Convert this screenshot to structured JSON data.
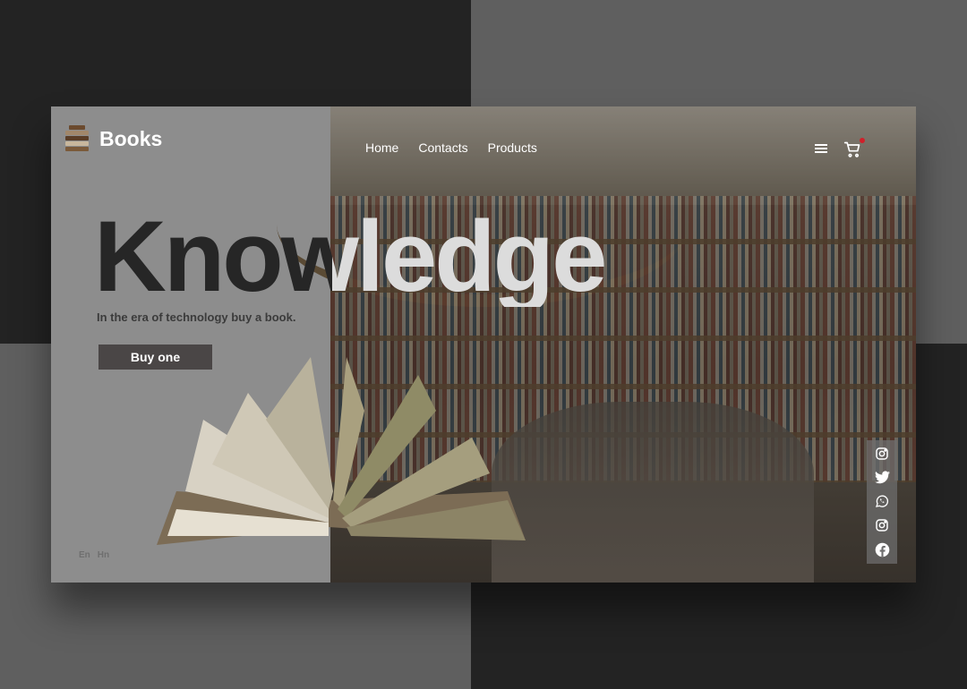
{
  "brand": {
    "name": "Books",
    "icon": "books-stack-icon"
  },
  "nav": {
    "items": [
      {
        "label": "Home"
      },
      {
        "label": "Contacts"
      },
      {
        "label": "Products"
      }
    ]
  },
  "header": {
    "menu_icon": "hamburger-menu-icon",
    "cart_icon": "cart-icon",
    "cart_badge_color": "#d0202a"
  },
  "hero": {
    "headline": "Knowledge",
    "subtitle": "In the era of technology buy a book.",
    "cta_label": "Buy one"
  },
  "languages": [
    "En",
    "Hn"
  ],
  "social": [
    "instagram-icon",
    "twitter-icon",
    "whatsapp-icon",
    "instagram-icon",
    "facebook-icon"
  ],
  "colors": {
    "dark_panel": "#232323",
    "mid_panel": "#5f5f5f",
    "left_panel": "#8d8d8d",
    "button": "#4a4646",
    "headline_dark": "#262626",
    "headline_light": "#dcdcdc"
  }
}
